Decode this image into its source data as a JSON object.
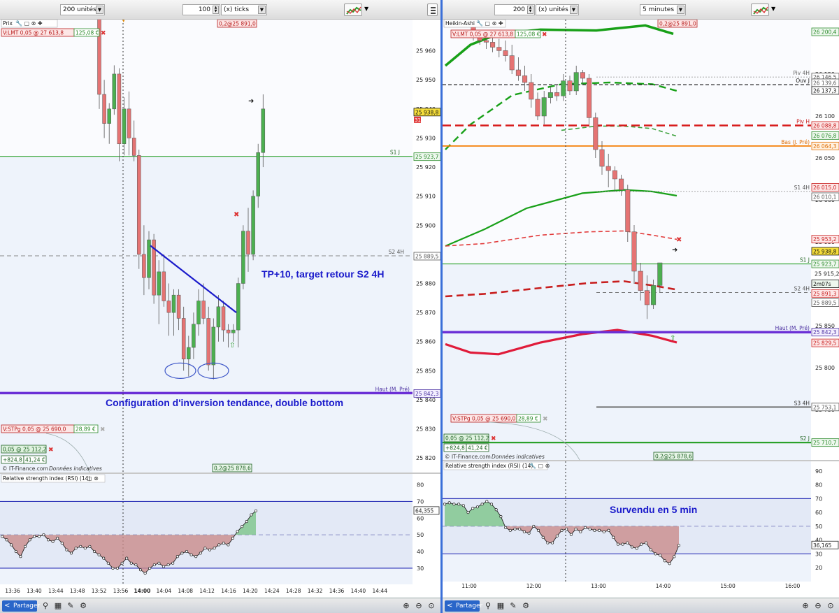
{
  "left": {
    "toolbar": {
      "units_value": "200 unités",
      "ticks_count": "100",
      "ticks_unit": "(x) ticks"
    },
    "price_label": "Prix",
    "order_tag": {
      "text": "V:LMT  0,05 @ 27 613,8",
      "pnl": "125,08 €"
    },
    "stop_tag": {
      "text": "V:STPg  0,05 @ 25 690,0",
      "pnl": "28,89 €"
    },
    "position": {
      "text": "0,05 @ 25 112,2",
      "points": "+824,8",
      "pnl": "41,24 €"
    },
    "top_marker": "0,2@25 891,0",
    "bottom_marker": "0,2@25 878,6",
    "copyright": "© IT-Finance.com",
    "copyright_note": "Données indicatives",
    "annotation_tp": "TP+10, target retour S2 4H",
    "annotation_config": "Configuration d'inversion tendance, double bottom",
    "rsi_label": "Relative strength index (RSI) (14)",
    "rsi_value": "64,355",
    "price_ticks": [
      "25 960",
      "25 950",
      "25 940",
      "25 930",
      "25 920",
      "25 910",
      "25 900",
      "25 890",
      "25 880",
      "25 870",
      "25 860",
      "25 850",
      "25 840",
      "25 830",
      "25 820"
    ],
    "rsi_ticks": [
      "80",
      "70",
      "60",
      "50",
      "40",
      "30"
    ],
    "time_ticks": [
      "13:36",
      "13:40",
      "13:44",
      "13:48",
      "13:52",
      "13:56",
      "14:00",
      "14:04",
      "14:08",
      "14:12",
      "14:16",
      "14:20",
      "14:24",
      "14:28",
      "14:32",
      "14:36",
      "14:40",
      "14:44"
    ],
    "level_labels": {
      "s1j": "S1 J",
      "s2_4h": "S2 4H",
      "haut_m": "Haut (M. Pré)"
    },
    "level_values": {
      "current": "25 938,8",
      "current_sub": "31",
      "s1j": "25 923,7",
      "s2_4h": "25 889,5",
      "haut_m": "25 842,3"
    },
    "bottom_bar": {
      "share": "Partager"
    }
  },
  "right": {
    "toolbar": {
      "units_count": "200",
      "units_value": "(x) unités",
      "timeframe": "5 minutes"
    },
    "price_label": "Heikin-Ashi",
    "order_tag": {
      "text": "V:LMT  0,05 @ 27 613,8",
      "pnl": "125,08 €"
    },
    "stop_tag": {
      "text": "V:STPg  0,05 @ 25 690,0",
      "pnl": "28,89 €"
    },
    "position": {
      "text": "0,05 @ 25 112,2",
      "points": "+824,8",
      "pnl": "41,24 €"
    },
    "top_marker": "0,2@25 891,0",
    "bottom_marker": "0,2@25 878,6",
    "copyright": "© IT-Finance.com",
    "copyright_note": "Données indicatives",
    "annotation": "Survendu en 5 min",
    "rsi_label": "Relative strength index (RSI) (14)",
    "rsi_value": "36,165",
    "price_ticks": [
      "26 150",
      "26 100",
      "26 050",
      "26 000",
      "25 950",
      "25 900",
      "25 850",
      "25 800",
      "25 750"
    ],
    "rsi_ticks": [
      "90",
      "80",
      "70",
      "60",
      "50",
      "40",
      "30",
      "20"
    ],
    "time_ticks": [
      "11:00",
      "12:00",
      "13:00",
      "14:00",
      "15:00",
      "16:00"
    ],
    "level_labels": {
      "piv4h": "Piv 4H",
      "ouvj": "Ouv J",
      "pivh": "Piv H",
      "basj": "Bas (J. Pré)",
      "s1_4h": "S1 4H",
      "s1j": "S1 J",
      "s2_4h": "S2 4H",
      "haut_m": "Haut (M. Pré)",
      "s3_4h": "S3 4H",
      "s2j": "S2 J"
    },
    "level_values": {
      "top": "26 200,4",
      "piv4h": "26 146,5",
      "ouvj_a": "26 139,6",
      "ouvj": "26 137,3",
      "pivh": "26 088,8",
      "g1": "26 076,8",
      "basj": "26 064,3",
      "s1_4h": "26 015,0",
      "s1_4h_b": "26 010,1",
      "r1": "25 953,2",
      "current": "25 938,8",
      "s1j": "25 923,7",
      "mid": "25 915,2",
      "timer": "2m07s",
      "r2": "25 891,3",
      "s2_4h": "25 889,5",
      "haut_m": "25 842,3",
      "r3": "25 829,5",
      "s3_4h": "25 753,1",
      "s2j": "25 710,7"
    },
    "bottom_bar": {
      "share": "Partager"
    }
  },
  "colors": {
    "up": "#4caf50",
    "down": "#e57373",
    "level_green": "#2aa12a",
    "level_purple": "#6b2fd6",
    "level_red": "#d81b1b",
    "level_orange": "#f57c00",
    "annotation_blue": "#1a1acb",
    "divider": "#3a6fd8"
  },
  "chart_data": [
    {
      "type": "candlestick",
      "title": "",
      "timeframe": "100 ticks",
      "ylim": [
        25815,
        25970
      ],
      "x_ticks": [
        "13:36",
        "13:40",
        "13:44",
        "13:48",
        "13:52",
        "13:56",
        "14:00",
        "14:04",
        "14:08",
        "14:12",
        "14:16",
        "14:20",
        "14:24",
        "14:28",
        "14:32",
        "14:36",
        "14:40",
        "14:44"
      ],
      "candles": [
        [
          25972,
          25972,
          25940,
          25945
        ],
        [
          25945,
          25950,
          25930,
          25935
        ],
        [
          25935,
          25942,
          25928,
          25940
        ],
        [
          25940,
          25955,
          25938,
          25952
        ],
        [
          25952,
          25954,
          25922,
          25928
        ],
        [
          25928,
          25944,
          25924,
          25940
        ],
        [
          25940,
          25946,
          25924,
          25930
        ],
        [
          25930,
          25936,
          25922,
          25924
        ],
        [
          25924,
          25926,
          25885,
          25890
        ],
        [
          25890,
          25900,
          25876,
          25882
        ],
        [
          25882,
          25898,
          25878,
          25895
        ],
        [
          25895,
          25897,
          25873,
          25876
        ],
        [
          25876,
          25888,
          25866,
          25884
        ],
        [
          25884,
          25890,
          25872,
          25874
        ],
        [
          25874,
          25880,
          25862,
          25870
        ],
        [
          25870,
          25878,
          25862,
          25876
        ],
        [
          25876,
          25878,
          25864,
          25868
        ],
        [
          25868,
          25872,
          25850,
          25854
        ],
        [
          25854,
          25862,
          25848,
          25858
        ],
        [
          25858,
          25870,
          25854,
          25866
        ],
        [
          25866,
          25878,
          25862,
          25874
        ],
        [
          25874,
          25880,
          25866,
          25868
        ],
        [
          25868,
          25872,
          25850,
          25852
        ],
        [
          25852,
          25868,
          25847,
          25865
        ],
        [
          25865,
          25876,
          25860,
          25872
        ],
        [
          25872,
          25874,
          25860,
          25864
        ],
        [
          25864,
          25866,
          25858,
          25863
        ],
        [
          25863,
          25866,
          25860,
          25864
        ],
        [
          25864,
          25882,
          25858,
          25880
        ],
        [
          25880,
          25900,
          25878,
          25898
        ],
        [
          25898,
          25906,
          25884,
          25890
        ],
        [
          25890,
          25912,
          25888,
          25910
        ],
        [
          25910,
          25928,
          25906,
          25925
        ],
        [
          25925,
          25945,
          25920,
          25940
        ]
      ],
      "candle_format": [
        "open",
        "high",
        "low",
        "close"
      ],
      "levels": [
        {
          "label": "S1 J",
          "value": 25923.7
        },
        {
          "label": "S2 4H",
          "value": 25889.5
        },
        {
          "label": "Haut (M. Pré)",
          "value": 25842.3
        }
      ],
      "trendline": [
        [
          25893,
          25870
        ]
      ],
      "rsi": {
        "ylim": [
          22,
          84
        ],
        "values": [
          49,
          47,
          44,
          40,
          37,
          43,
          47,
          49,
          49,
          50,
          47,
          46,
          48,
          45,
          41,
          39,
          42,
          43,
          42,
          43,
          40,
          38,
          36,
          33,
          30,
          30,
          33,
          36,
          33,
          32,
          29,
          27,
          30,
          32,
          33,
          31,
          32,
          33,
          37,
          39,
          40,
          38,
          37,
          39,
          42,
          41,
          42,
          44,
          45,
          44,
          48,
          52,
          55,
          58,
          62,
          64.355
        ],
        "overbought": 70,
        "oversold": 30,
        "mid": 50
      }
    },
    {
      "type": "candlestick",
      "title": "",
      "timeframe": "5 minutes",
      "ylim": [
        25690,
        26215
      ],
      "x_ticks": [
        "11:00",
        "12:00",
        "13:00",
        "14:00",
        "15:00",
        "16:00"
      ],
      "candles": [
        [
          26210,
          26210,
          26190,
          26195
        ],
        [
          26195,
          26200,
          26185,
          26190
        ],
        [
          26190,
          26200,
          26180,
          26188
        ],
        [
          26188,
          26196,
          26176,
          26182
        ],
        [
          26182,
          26192,
          26170,
          26178
        ],
        [
          26178,
          26190,
          26165,
          26172
        ],
        [
          26172,
          26185,
          26150,
          26155
        ],
        [
          26155,
          26170,
          26142,
          26148
        ],
        [
          26148,
          26160,
          26130,
          26140
        ],
        [
          26140,
          26150,
          26110,
          26120
        ],
        [
          26120,
          26128,
          26095,
          26100
        ],
        [
          26100,
          26130,
          26090,
          26122
        ],
        [
          26122,
          26135,
          26115,
          26128
        ],
        [
          26128,
          26138,
          26118,
          26124
        ],
        [
          26124,
          26150,
          26118,
          26142
        ],
        [
          26142,
          26148,
          26125,
          26130
        ],
        [
          26130,
          26160,
          26125,
          26152
        ],
        [
          26152,
          26155,
          26138,
          26145
        ],
        [
          26145,
          26150,
          26090,
          26098
        ],
        [
          26098,
          26104,
          26050,
          26060
        ],
        [
          26060,
          26070,
          26030,
          26040
        ],
        [
          26040,
          26055,
          26015,
          26035
        ],
        [
          26035,
          26040,
          26010,
          26025
        ],
        [
          26025,
          26030,
          26005,
          26012
        ],
        [
          26012,
          26018,
          25950,
          25962
        ],
        [
          25962,
          25970,
          25900,
          25915
        ],
        [
          25915,
          25925,
          25880,
          25892
        ],
        [
          25892,
          25910,
          25858,
          25875
        ],
        [
          25875,
          25905,
          25870,
          25898
        ],
        [
          25898,
          25910,
          25890,
          25925
        ]
      ],
      "candle_format": [
        "open",
        "high",
        "low",
        "close"
      ],
      "levels": [
        {
          "label": "Piv 4H",
          "value": 26146.5
        },
        {
          "label": "Ouv J",
          "value": 26137.3
        },
        {
          "label": "Piv H",
          "value": 26088.8
        },
        {
          "label": "Bas (J. Pré)",
          "value": 26064.3
        },
        {
          "label": "S1 4H",
          "value": 26010.1
        },
        {
          "label": "S1 J",
          "value": 25923.7
        },
        {
          "label": "S2 4H",
          "value": 25889.5
        },
        {
          "label": "Haut (M. Pré)",
          "value": 25842.3
        },
        {
          "label": "S3 4H",
          "value": 25753.1
        },
        {
          "label": "S2 J",
          "value": 25710.7
        }
      ],
      "rsi": {
        "ylim": [
          12,
          95
        ],
        "values": [
          66,
          67,
          66,
          66,
          65,
          60,
          63,
          64,
          66,
          68,
          66,
          62,
          57,
          49,
          47,
          48,
          48,
          46,
          45,
          50,
          47,
          42,
          38,
          38,
          43,
          47,
          48,
          44,
          48,
          46,
          49,
          48,
          47,
          47,
          46,
          47,
          42,
          37,
          37,
          38,
          35,
          34,
          37,
          38,
          33,
          30,
          29,
          25,
          23,
          28,
          36.165
        ],
        "overbought": 70,
        "oversold": 30,
        "mid": 50
      }
    }
  ]
}
